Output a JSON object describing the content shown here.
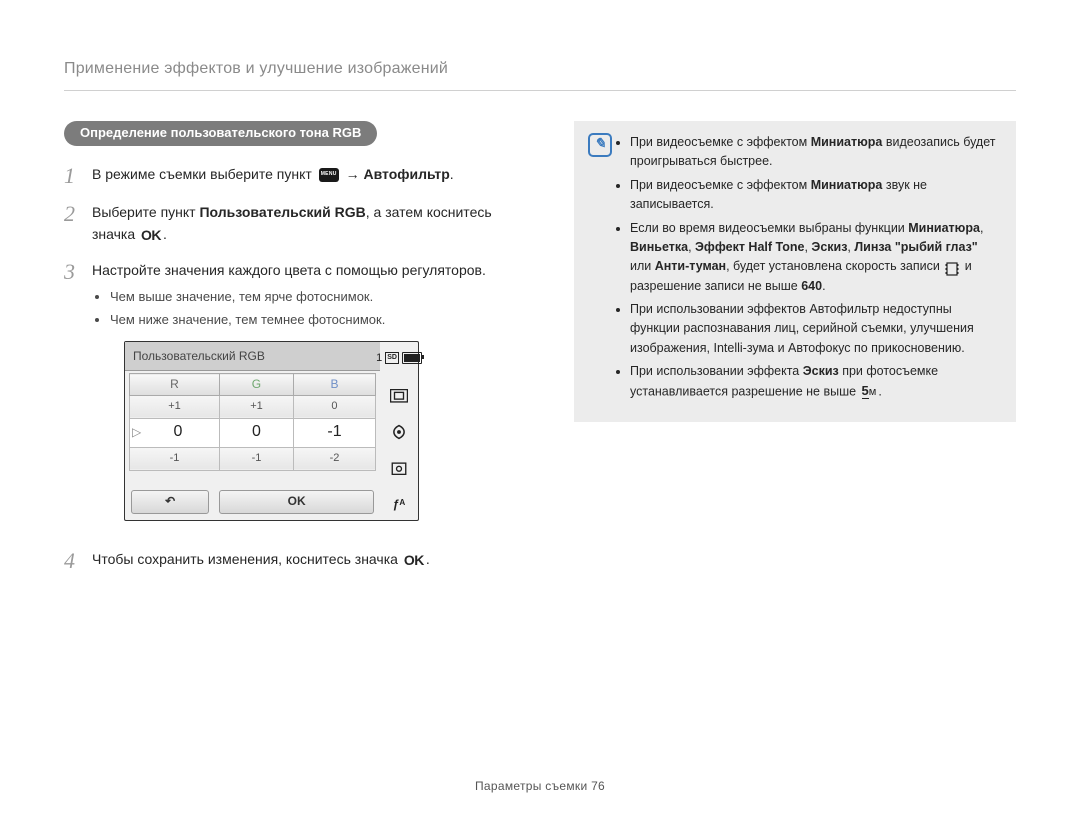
{
  "header": {
    "title": "Применение эффектов и улучшение изображений"
  },
  "left": {
    "badge": "Определение пользовательского тона RGB",
    "step1_pre": "В режиме съемки выберите пункт ",
    "step1_arrow": " → ",
    "step1_bold": "Автофильтр",
    "step1_dot": ".",
    "step2_pre": "Выберите пункт ",
    "step2_bold": "Пользовательский RGB",
    "step2_mid": ", а затем коснитесь значка ",
    "step2_ok": "OK",
    "step2_dot": ".",
    "step3": "Настройте значения каждого цвета с помощью регуляторов.",
    "step3_b1": "Чем выше значение, тем ярче фотоснимок.",
    "step3_b2": "Чем ниже значение, тем темнее фотоснимок.",
    "step4_pre": "Чтобы сохранить изменения, коснитесь значка ",
    "step4_ok": "OK",
    "step4_dot": "."
  },
  "screen": {
    "title": "Пользовательский RGB",
    "h": {
      "r": "R",
      "g": "G",
      "b": "B"
    },
    "row_up": {
      "r": "+1",
      "g": "+1",
      "b": "0"
    },
    "row_mid": {
      "r": "0",
      "g": "0",
      "b": "-1"
    },
    "row_dn": {
      "r": "-1",
      "g": "-1",
      "b": "-2"
    },
    "btn_back": "↶",
    "btn_ok": "OK",
    "right_top": "1",
    "icon_sd": "SD",
    "flash": "ƒᴬ"
  },
  "notes": {
    "n1_pre": "При видеосъемке с эффектом ",
    "n1_bold": "Миниатюра",
    "n1_post": " видеозапись будет проигрываться быстрее.",
    "n2_pre": "При видеосъемке с эффектом ",
    "n2_bold": "Миниатюра",
    "n2_post": " звук не записывается.",
    "n3_pre": "Если во время видеосъемки выбраны функции ",
    "n3_b1": "Миниатюра",
    "n3_c1": ", ",
    "n3_b2": "Виньетка",
    "n3_c2": ", ",
    "n3_b3": "Эффект Half Tone",
    "n3_c3": ", ",
    "n3_b4": "Эскиз",
    "n3_c4": ", ",
    "n3_b5": "Линза \"рыбий глаз\"",
    "n3_post1": " или ",
    "n3_b6": "Анти-туман",
    "n3_post2": ", будет установлена скорость записи ",
    "n3_post3": " и разрешение записи не выше ",
    "n3_b7": "640",
    "n3_dot": ".",
    "n4": "При использовании эффектов Автофильтр недоступны функции распознавания лиц, серийной съемки, улучшения изображения, Intelli-зума и Автофокус по прикосновению.",
    "n5_pre": "При использовании эффекта ",
    "n5_bold": "Эскиз",
    "n5_mid": " при фотосъемке устанавливается разрешение не выше ",
    "n5_dot": "."
  },
  "footer": {
    "text": "Параметры съемки  76"
  }
}
